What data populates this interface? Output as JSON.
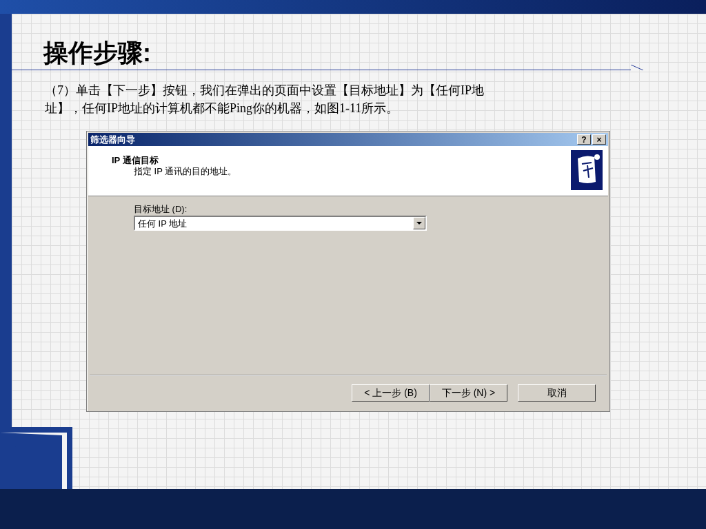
{
  "slide": {
    "title": "操作步骤:",
    "lines": [
      "（7）单击【下一步】按钮，我们在弹出的页面中设置【目标地址】为【任何IP地",
      "址】，任何IP地址的计算机都不能Ping你的机器，如图1-11所示。"
    ]
  },
  "dialog": {
    "title": "筛选器向导",
    "title_buttons": [
      "?",
      "×"
    ],
    "header_title": "IP 通信目标",
    "header_subtitle": "指定 IP 通讯的目的地址。",
    "field_label": "目标地址 (D):",
    "field_value": "任何 IP 地址",
    "buttons": [
      "< 上一步 (B)",
      "下一步 (N) >",
      "取消"
    ]
  }
}
